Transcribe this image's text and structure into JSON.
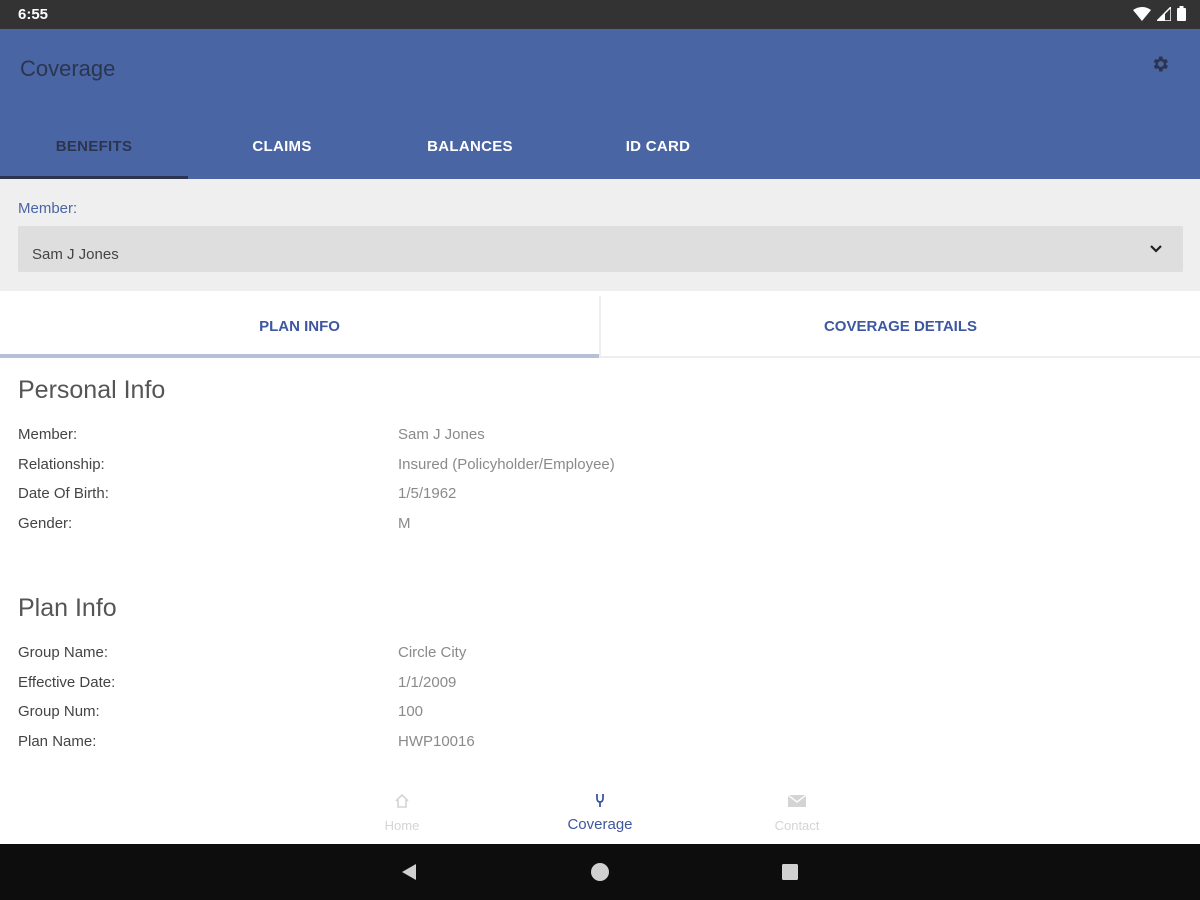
{
  "status_bar": {
    "time": "6:55"
  },
  "app_bar": {
    "title": "Coverage"
  },
  "top_tabs": [
    {
      "label": "BENEFITS",
      "active": true
    },
    {
      "label": "CLAIMS",
      "active": false
    },
    {
      "label": "BALANCES",
      "active": false
    },
    {
      "label": "ID CARD",
      "active": false
    }
  ],
  "member": {
    "label": "Member:",
    "selected": "Sam J Jones"
  },
  "sub_tabs": [
    {
      "label": "PLAN INFO",
      "active": true
    },
    {
      "label": "COVERAGE DETAILS",
      "active": false
    }
  ],
  "personal_info": {
    "title": "Personal Info",
    "rows": [
      {
        "label": "Member:",
        "value": "Sam J Jones"
      },
      {
        "label": "Relationship:",
        "value": "Insured (Policyholder/Employee)"
      },
      {
        "label": "Date Of Birth:",
        "value": "1/5/1962"
      },
      {
        "label": "Gender:",
        "value": "M"
      }
    ]
  },
  "plan_info": {
    "title": "Plan Info",
    "rows": [
      {
        "label": "Group Name:",
        "value": "Circle City"
      },
      {
        "label": "Effective Date:",
        "value": "1/1/2009"
      },
      {
        "label": "Group Num:",
        "value": "100"
      },
      {
        "label": "Plan Name:",
        "value": "HWP10016"
      }
    ]
  },
  "bottom_nav": [
    {
      "label": "Home",
      "icon": "home-icon",
      "active": false
    },
    {
      "label": "Coverage",
      "icon": "coverage-icon",
      "active": true
    },
    {
      "label": "Contact",
      "icon": "mail-icon",
      "active": false
    }
  ],
  "colors": {
    "primary": "#4a65a3",
    "primary_dark": "#2c3550",
    "accent_text": "#3d57a1",
    "status_bar": "#333333",
    "system_nav": "#0d0d0d"
  }
}
